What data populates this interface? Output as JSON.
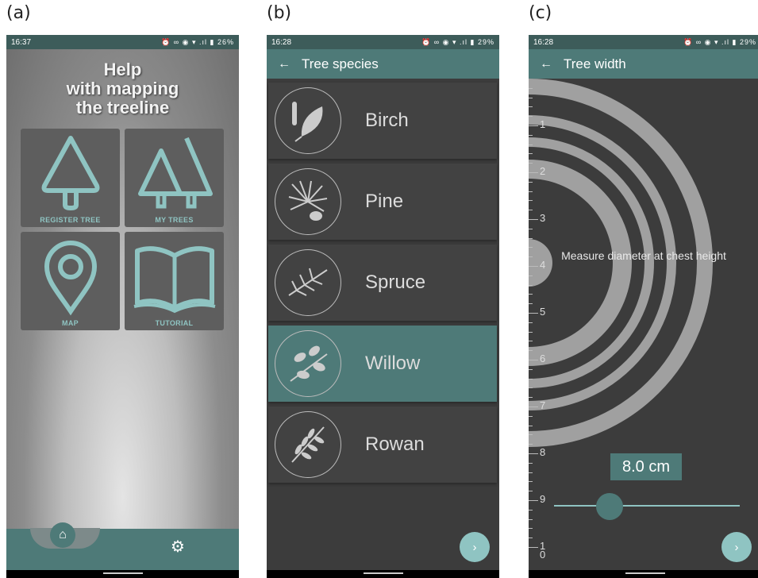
{
  "labels": {
    "a": "(a)",
    "b": "(b)",
    "c": "(c)"
  },
  "phone_a": {
    "status_time": "16:37",
    "status_icons": "⏰ ∞ ◉ ▾ .ıl ▮ 26%",
    "title_lines": [
      "Help",
      "with mapping",
      "the treeline"
    ],
    "tiles": [
      {
        "label": "REGISTER TREE",
        "icon": "tree-icon"
      },
      {
        "label": "MY TREES",
        "icon": "two-trees-icon"
      },
      {
        "label": "MAP",
        "icon": "map-pin-icon"
      },
      {
        "label": "TUTORIAL",
        "icon": "book-icon"
      }
    ],
    "nav": {
      "home_icon": "⌂",
      "settings_icon": "⚙"
    }
  },
  "phone_b": {
    "status_time": "16:28",
    "status_icons": "⏰ ∞ ◉ ▾ .ıl ▮ 29%",
    "back": "←",
    "title": "Tree species",
    "species": [
      {
        "name": "Birch",
        "icon": "birch-leaf-icon",
        "selected": false
      },
      {
        "name": "Pine",
        "icon": "pine-icon",
        "selected": false
      },
      {
        "name": "Spruce",
        "icon": "spruce-icon",
        "selected": false
      },
      {
        "name": "Willow",
        "icon": "willow-leaf-icon",
        "selected": true
      },
      {
        "name": "Rowan",
        "icon": "rowan-leaf-icon",
        "selected": false
      }
    ],
    "next": "›"
  },
  "phone_c": {
    "status_time": "16:28",
    "status_icons": "⏰ ∞ ◉ ▾ .ıl ▮ 29%",
    "back": "←",
    "title": "Tree width",
    "ruler_labels": [
      "1",
      "2",
      "3",
      "4",
      "5",
      "6",
      "7",
      "8",
      "9",
      "1\n0"
    ],
    "instruction": "Measure diameter at chest height",
    "value": "8.0 cm",
    "slider_fraction": 0.3,
    "next": "›"
  },
  "colors": {
    "accent": "#4e7a78",
    "accent_light": "#8fc4c2",
    "dark_bg": "#3c3c3c"
  }
}
